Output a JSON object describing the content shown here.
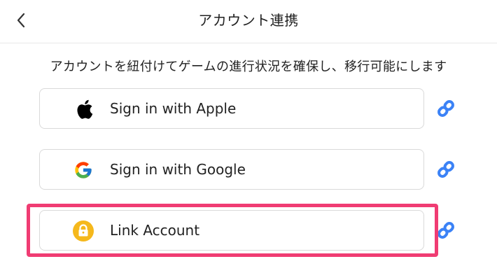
{
  "header": {
    "title": "アカウント連携"
  },
  "subtitle": "アカウントを紐付けてゲームの進行状況を確保し、移行可能にします",
  "options": [
    {
      "label": "Sign in with Apple",
      "logo": "apple-logo-icon"
    },
    {
      "label": "Sign in with Google",
      "logo": "google-logo-icon"
    },
    {
      "label": "Link Account",
      "logo": "lock-icon"
    }
  ],
  "colors": {
    "link_icon": "#3b82f6",
    "highlight": "#f03c73",
    "lock_badge": "#f5b81c"
  }
}
